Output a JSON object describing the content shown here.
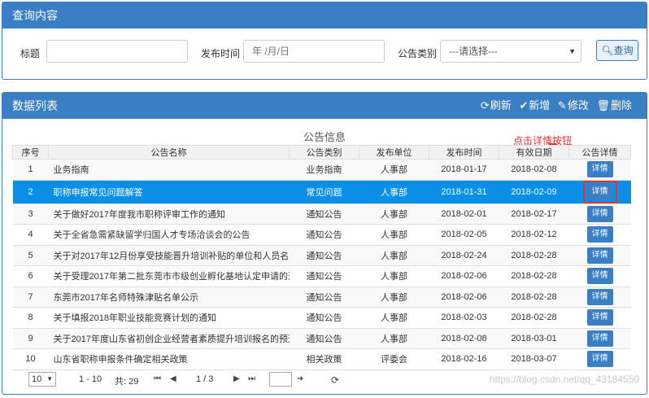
{
  "query": {
    "title": "查询内容",
    "title_label": "标题",
    "title_value": "",
    "date_label": "发布时间",
    "date_placeholder": "年 /月/日",
    "category_label": "公告类别",
    "category_selected": "---请选择---",
    "search_label": "查询"
  },
  "list": {
    "title": "数据列表",
    "toolbar": {
      "refresh": "刷新",
      "add": "新增",
      "edit": "修改",
      "delete": "删除"
    },
    "table_title": "公告信息",
    "annotation": "点击详情按钮",
    "columns": [
      "序号",
      "公告名称",
      "公告类别",
      "发布单位",
      "发布时间",
      "有效日期",
      "公告详情"
    ],
    "detail_label": "详情",
    "rows": [
      [
        "1",
        "业务指南",
        "业务指南",
        "人事部",
        "2018-01-17",
        "2018-02-08"
      ],
      [
        "2",
        "职称申报常见问题解答",
        "常见问题",
        "人事部",
        "2018-01-31",
        "2018-02-09"
      ],
      [
        "3",
        "关于做好2017年度我市职称评审工作的通知",
        "通知公告",
        "人事部",
        "2018-02-01",
        "2018-02-17"
      ],
      [
        "4",
        "关于全省急需紧缺留学归国人才专场洽谈会的公告",
        "通知公告",
        "人事部",
        "2018-02-05",
        "2018-02-12"
      ],
      [
        "5",
        "关于对2017年12月份享受技能晋升培训补贴的单位和人员名单公示",
        "通知公告",
        "人事部",
        "2018-02-24",
        "2018-02-28"
      ],
      [
        "6",
        "关于受理2017年第二批东莞市市级创业孵化基地认定申请的通告",
        "通知公告",
        "人事部",
        "2018-02-06",
        "2018-02-28"
      ],
      [
        "7",
        "东莞市2017年名师特殊津贴名单公示",
        "通知公告",
        "人事部",
        "2018-02-06",
        "2018-02-28"
      ],
      [
        "8",
        "关于填报2018年职业技能竞赛计划的通知",
        "通知公告",
        "人事部",
        "2018-02-03",
        "2018-02-28"
      ],
      [
        "9",
        "关于2017年度山东省初创企业经营者素质提升培训报名的预通知",
        "通知公告",
        "人事部",
        "2018-02-08",
        "2018-03-01"
      ],
      [
        "10",
        "山东省职称申报条件确定相关政策",
        "相关政策",
        "评委会",
        "2018-02-16",
        "2018-03-07"
      ]
    ],
    "selected_row": 1,
    "pager": {
      "page_size": "10",
      "range": "1 - 10",
      "total": "共: 29",
      "page": "1 / 3"
    }
  },
  "watermark": "https://blog.csdn.net/qq_43184550",
  "colors": {
    "primary": "#3a7fc4",
    "selected": "#0a8fe6",
    "annotation": "#e8312f"
  }
}
